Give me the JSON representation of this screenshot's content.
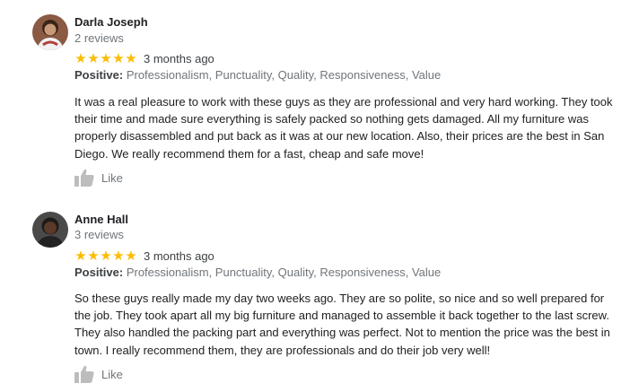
{
  "reviews": [
    {
      "author": "Darla Joseph",
      "review_count": "2 reviews",
      "rating": 5,
      "date": "3 months ago",
      "positive_label": "Positive:",
      "positive_values": "Professionalism, Punctuality, Quality, Responsiveness, Value",
      "text": "It was a real pleasure to work with these guys as they are professional and very hard working. They took their time and made sure everything is safely packed so nothing gets damaged. All my furniture was properly disassembled and put back as it was at our new location. Also, their prices are the best in San Diego. We really recommend them for a fast, cheap  and safe move!",
      "like_label": "Like",
      "like_icon": "thumbs-up-icon",
      "avatar_icon": "avatar-photo"
    },
    {
      "author": "Anne Hall",
      "review_count": "3 reviews",
      "rating": 5,
      "date": "3 months ago",
      "positive_label": "Positive:",
      "positive_values": "Professionalism, Punctuality, Quality, Responsiveness, Value",
      "text": "So these guys really made my day two weeks ago. They are so polite, so nice and so well prepared for the job. They took apart all my big furniture and managed to assemble it back together to the last screw. They also handled the packing part and everything was perfect. Not to mention the price was the best in town. I really recommend them, they are professionals and do their job very well!",
      "like_label": "Like",
      "like_icon": "thumbs-up-icon",
      "avatar_icon": "avatar-photo"
    }
  ],
  "colors": {
    "star": "#fbbc04",
    "muted_text": "#70757a",
    "body_text": "#202124",
    "like_icon": "#bdbdbd"
  }
}
